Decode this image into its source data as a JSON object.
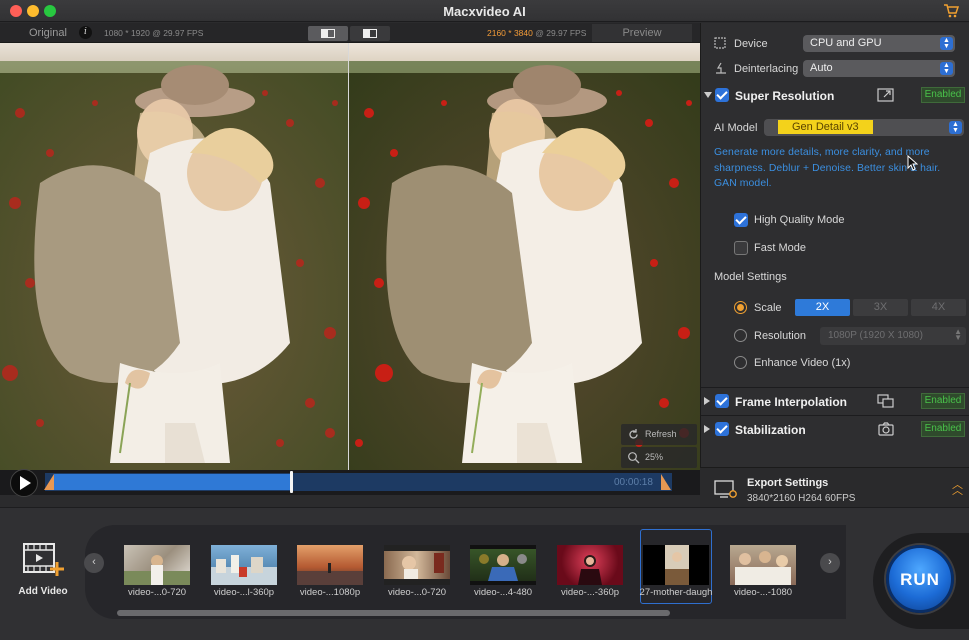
{
  "app": {
    "title": "Macxvideo AI"
  },
  "preview_header": {
    "original_label": "Original",
    "info_symbol": "i",
    "left_resolution": "1080 * 1920 @ 29.97 FPS",
    "right_resolution_hi": "2160 * 3840",
    "right_resolution_rest": " @ 29.97 FPS",
    "preview_label": "Preview"
  },
  "preview_overlay": {
    "refresh_label": "Refresh",
    "zoom_label": "25%"
  },
  "timeline": {
    "timecode": "00:00:18",
    "progress_fraction": 0.39
  },
  "settings": {
    "device_label": "Device",
    "device_value": "CPU and GPU",
    "deinterlacing_label": "Deinterlacing",
    "deinterlacing_value": "Auto",
    "super_resolution": {
      "title": "Super Resolution",
      "status": "Enabled",
      "checked": true,
      "ai_model_label": "AI Model",
      "ai_model_value": "Gen Detail v3",
      "description": "Generate more details, more clarity, and more sharpness. Deblur + Denoise. Better skin & hair. GAN model.",
      "high_quality_label": "High Quality Mode",
      "high_quality_checked": true,
      "fast_mode_label": "Fast Mode",
      "fast_mode_checked": false,
      "model_settings_label": "Model Settings",
      "scale_label": "Scale",
      "scale_options": [
        "2X",
        "3X",
        "4X"
      ],
      "scale_selected": "2X",
      "resolution_label": "Resolution",
      "resolution_value": "1080P (1920 X 1080)",
      "enhance_label": "Enhance Video (1x)"
    },
    "frame_interpolation": {
      "title": "Frame Interpolation",
      "status": "Enabled",
      "checked": true
    },
    "stabilization": {
      "title": "Stabilization",
      "status": "Enabled",
      "checked": true
    }
  },
  "export": {
    "title": "Export Settings",
    "subtitle": "3840*2160 H264 60FPS"
  },
  "media_bar": {
    "add_video_label": "Add Video",
    "clips": [
      {
        "label": "video-...0-720"
      },
      {
        "label": "video-...l-360p"
      },
      {
        "label": "video-...1080p"
      },
      {
        "label": "video-...0-720"
      },
      {
        "label": "video-...4-480"
      },
      {
        "label": "video-...-360p"
      },
      {
        "label": "27-mother-daugh"
      },
      {
        "label": "video-...-1080"
      }
    ],
    "selected_clip_index": 6
  },
  "run_label": "RUN",
  "colors": {
    "accent_blue": "#2d72d9",
    "enabled_green": "#49c14a",
    "accent_orange": "#f0a031",
    "ai_model_yellow": "#f3d21b"
  }
}
